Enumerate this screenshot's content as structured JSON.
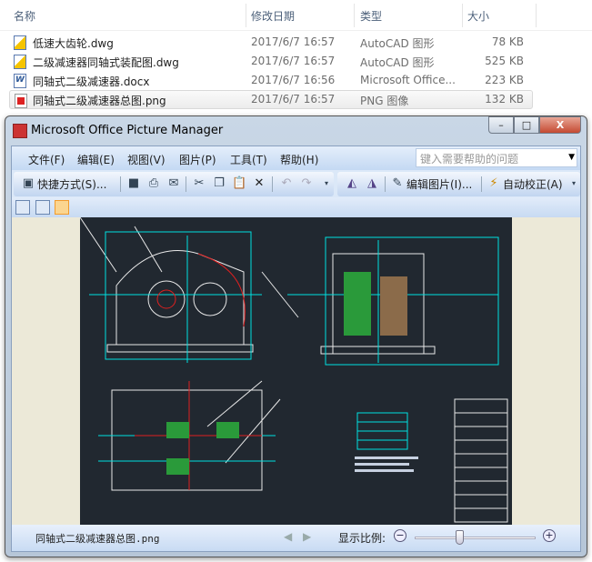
{
  "explorer": {
    "columns": [
      "名称",
      "修改日期",
      "类型",
      "大小"
    ],
    "files": [
      {
        "name": "低速大齿轮.dwg",
        "date": "2017/6/7 16:57",
        "type": "AutoCAD 图形",
        "size": "78 KB",
        "icon": "dwg-file-icon"
      },
      {
        "name": "二级减速器同轴式装配图.dwg",
        "date": "2017/6/7 16:57",
        "type": "AutoCAD 图形",
        "size": "525 KB",
        "icon": "dwg-file-icon"
      },
      {
        "name": "同轴式二级减速器.docx",
        "date": "2017/6/7 16:56",
        "type": "Microsoft Office...",
        "size": "223 KB",
        "icon": "docx-file-icon"
      },
      {
        "name": "同轴式二级减速器总图.png",
        "date": "2017/6/7 16:57",
        "type": "PNG 图像",
        "size": "132 KB",
        "icon": "png-file-icon"
      }
    ]
  },
  "window": {
    "title": "Microsoft Office Picture Manager",
    "menu": [
      "文件(F)",
      "编辑(E)",
      "视图(V)",
      "图片(P)",
      "工具(T)",
      "帮助(H)"
    ],
    "help_placeholder": "键入需要帮助的问题",
    "toolbar": {
      "shortcuts": "快捷方式(S)...",
      "edit_picture": "编辑图片(I)...",
      "auto_correct": "自动校正(A)"
    },
    "status": {
      "filename": "同轴式二级减速器总图.png",
      "zoom_label": "显示比例:",
      "zoom_fraction": 0.37
    }
  }
}
